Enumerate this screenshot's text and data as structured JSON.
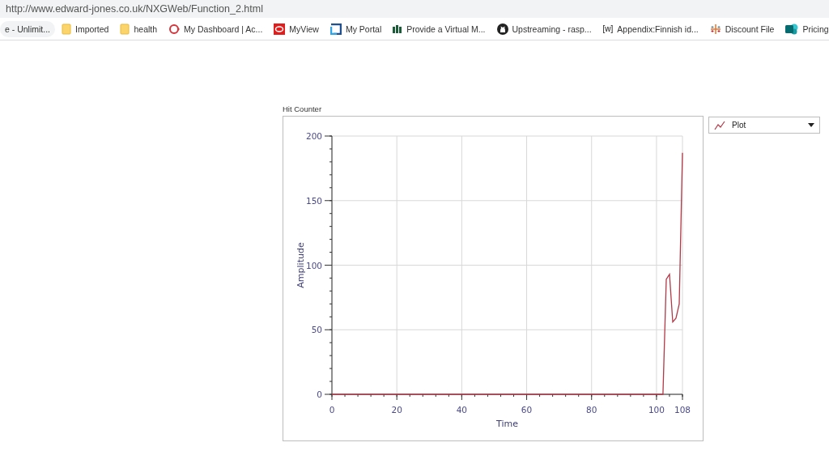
{
  "address_bar": {
    "url": "http://www.edward-jones.co.uk/NXGWeb/Function_2.html"
  },
  "bookmarks": [
    {
      "label": "e - Unlimit...",
      "kind": "none",
      "selected": true
    },
    {
      "label": "Imported",
      "kind": "folder",
      "selected": false
    },
    {
      "label": "health",
      "kind": "folder",
      "selected": false
    },
    {
      "label": "My Dashboard | Ac...",
      "kind": "ring",
      "selected": false
    },
    {
      "label": "MyView",
      "kind": "oval-square",
      "selected": false
    },
    {
      "label": "My Portal",
      "kind": "portal",
      "selected": false
    },
    {
      "label": "Provide a Virtual M...",
      "kind": "bars",
      "selected": false
    },
    {
      "label": "Upstreaming - rasp...",
      "kind": "cat",
      "selected": false
    },
    {
      "label": "Appendix:Finnish id...",
      "kind": "text",
      "icon_text": "[w]",
      "selected": false
    },
    {
      "label": "Discount File",
      "kind": "cross",
      "selected": false
    },
    {
      "label": "Pricing",
      "kind": "teal",
      "selected": false
    }
  ],
  "chart_panel": {
    "title": "Hit Counter",
    "chart_data": {
      "type": "line",
      "xlabel": "Time",
      "ylabel": "Amplitude",
      "x": [
        0,
        102,
        103,
        104,
        105,
        106,
        107,
        108
      ],
      "series": [
        {
          "name": "Plot",
          "color": "#b03a48",
          "values": [
            0,
            0,
            89,
            93,
            56,
            59,
            70,
            187
          ]
        }
      ],
      "xlim": [
        0,
        108
      ],
      "ylim": [
        0,
        200
      ],
      "xticks": [
        0,
        20,
        40,
        60,
        80,
        100,
        108
      ],
      "yticks": [
        0,
        50,
        100,
        150,
        200
      ],
      "grid": true
    }
  }
}
